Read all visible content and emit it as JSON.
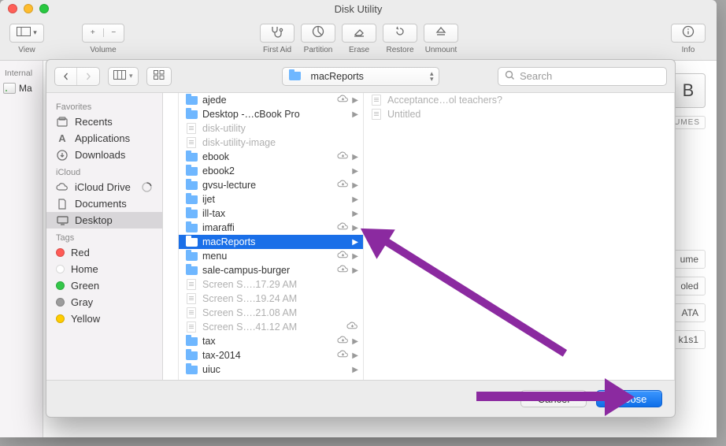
{
  "window": {
    "title": "Disk Utility"
  },
  "toolbar": {
    "view": "View",
    "volume": "Volume",
    "first_aid": "First Aid",
    "partition": "Partition",
    "erase": "Erase",
    "restore": "Restore",
    "unmount": "Unmount",
    "info": "Info"
  },
  "background_sidebar": {
    "header": "Internal",
    "item": "Ma"
  },
  "right_fragments": {
    "b": "B",
    "umes": "UMES",
    "r0": "ume",
    "r1": "oled",
    "r2": "ATA",
    "r3": "k1s1"
  },
  "dialog": {
    "path_label": "macReports",
    "search_placeholder": "Search",
    "cancel": "Cancel",
    "choose": "Choose",
    "sidebar": {
      "favorites": "Favorites",
      "recents": "Recents",
      "applications": "Applications",
      "downloads": "Downloads",
      "icloud_hdr": "iCloud",
      "icloud_drive": "iCloud Drive",
      "documents": "Documents",
      "desktop": "Desktop",
      "tags_hdr": "Tags",
      "red": "Red",
      "home": "Home",
      "green": "Green",
      "gray": "Gray",
      "yellow": "Yellow"
    },
    "col2": [
      {
        "name": "ajede",
        "type": "folder",
        "cloud": true,
        "arrow": true
      },
      {
        "name": "Desktop -…cBook Pro",
        "type": "folder",
        "cloud": false,
        "arrow": true
      },
      {
        "name": "disk-utility",
        "type": "file",
        "dim": true
      },
      {
        "name": "disk-utility-image",
        "type": "file",
        "dim": true
      },
      {
        "name": "ebook",
        "type": "folder",
        "cloud": true,
        "arrow": true
      },
      {
        "name": "ebook2",
        "type": "folder",
        "cloud": false,
        "arrow": true
      },
      {
        "name": "gvsu-lecture",
        "type": "folder",
        "cloud": true,
        "arrow": true
      },
      {
        "name": "ijet",
        "type": "folder",
        "cloud": false,
        "arrow": true
      },
      {
        "name": "ill-tax",
        "type": "folder",
        "cloud": false,
        "arrow": true
      },
      {
        "name": "imaraffi",
        "type": "folder",
        "cloud": true,
        "arrow": true
      },
      {
        "name": "macReports",
        "type": "folder",
        "cloud": false,
        "arrow": true,
        "selected": true
      },
      {
        "name": "menu",
        "type": "folder",
        "cloud": true,
        "arrow": true
      },
      {
        "name": "sale-campus-burger",
        "type": "folder",
        "cloud": true,
        "arrow": true
      },
      {
        "name": "Screen S….17.29 AM",
        "type": "file",
        "dim": true
      },
      {
        "name": "Screen S….19.24 AM",
        "type": "file",
        "dim": true
      },
      {
        "name": "Screen S….21.08 AM",
        "type": "file",
        "dim": true
      },
      {
        "name": "Screen S….41.12 AM",
        "type": "file",
        "dim": true,
        "cloud": true
      },
      {
        "name": "tax",
        "type": "folder",
        "cloud": true,
        "arrow": true
      },
      {
        "name": "tax-2014",
        "type": "folder",
        "cloud": true,
        "arrow": true
      },
      {
        "name": "uiuc",
        "type": "folder",
        "cloud": false,
        "arrow": true
      }
    ],
    "col3": [
      {
        "name": "Acceptance…ol teachers?",
        "type": "file",
        "dim": true
      },
      {
        "name": "Untitled",
        "type": "file",
        "dim": true
      }
    ]
  }
}
